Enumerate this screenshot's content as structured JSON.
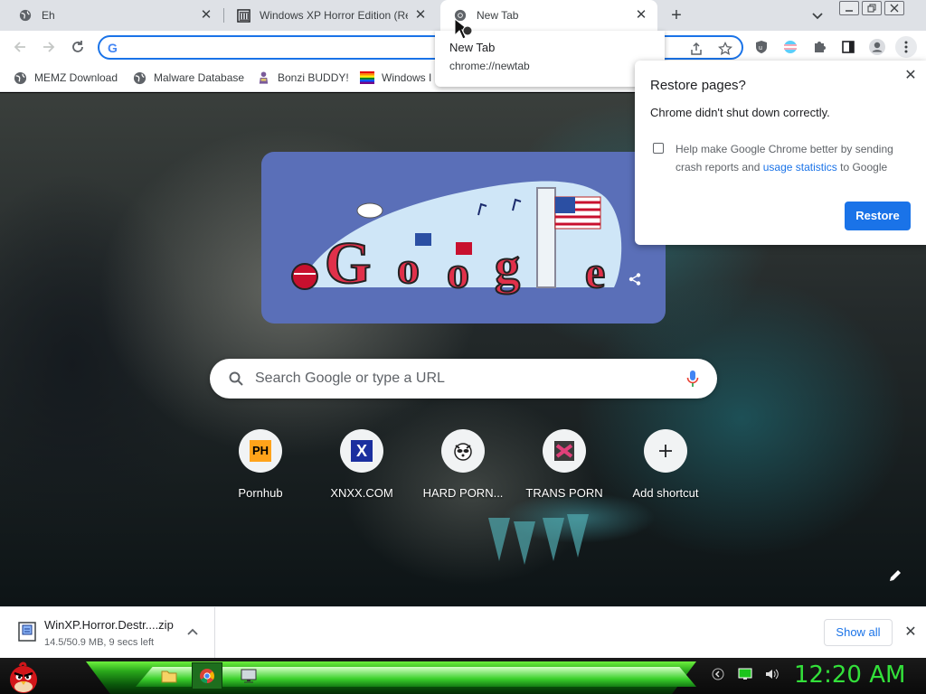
{
  "tabs": [
    {
      "title": "Eh",
      "icon": "globe-icon"
    },
    {
      "title": "Windows XP Horror Edition (Rea",
      "icon": "museum-icon"
    },
    {
      "title": "New Tab",
      "icon": "chrome-icon",
      "active": true
    }
  ],
  "omnibox": {
    "value": "",
    "placeholder": ""
  },
  "bookmarks": [
    {
      "label": "MEMZ Download",
      "icon": "globe-icon"
    },
    {
      "label": "Malware Database",
      "icon": "globe-icon"
    },
    {
      "label": "Bonzi BUDDY!",
      "icon": "bonzi-icon"
    },
    {
      "label": "Windows I",
      "icon": "rainbow-flag-icon"
    }
  ],
  "hovercard": {
    "title": "New Tab",
    "url": "chrome://newtab"
  },
  "restore": {
    "title": "Restore pages?",
    "message": "Chrome didn't shut down correctly.",
    "check_text_1": "Help make Google Chrome better by sending crash reports and",
    "check_link": "usage statistics",
    "check_text_2": "to Google",
    "checked": false,
    "button": "Restore"
  },
  "search": {
    "placeholder": "Search Google or type a URL"
  },
  "shortcuts": [
    {
      "label": "Pornhub",
      "icon": "ph-icon"
    },
    {
      "label": "XNXX.COM",
      "icon": "x-icon"
    },
    {
      "label": "HARD PORN...",
      "icon": "raccoon-icon"
    },
    {
      "label": "TRANS PORN",
      "icon": "site-icon"
    },
    {
      "label": "Add shortcut",
      "icon": "plus-icon"
    }
  ],
  "download": {
    "filename": "WinXP.Horror.Destr....zip",
    "status": "14.5/50.9 MB, 9 secs left",
    "show_all": "Show all"
  },
  "taskbar": {
    "clock": "12:20 AM"
  },
  "colors": {
    "accent": "#1a73e8",
    "clock": "#33e03a",
    "taskbar_green": "#29a81b",
    "doodle_bg": "#5a6fb8"
  }
}
